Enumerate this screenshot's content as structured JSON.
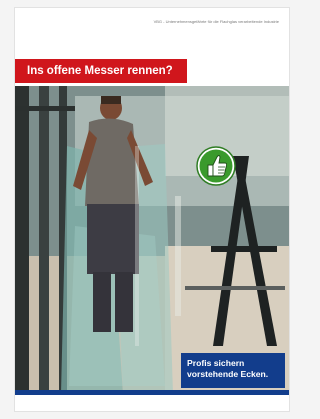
{
  "document": {
    "header_note": "VBG - Unternehmensgefährte für die Flachglas verarbeitende Industrie",
    "headline": "Ins offene Messer rennen?",
    "callout": {
      "line1": "Profis sichern",
      "line2": "vorstehende Ecken."
    }
  },
  "colors": {
    "headline_red": "#d0161c",
    "callout_blue": "#123d8c",
    "thumb_green": "#3a9a2c"
  },
  "icons": {
    "badge": "thumbs-up-icon"
  }
}
